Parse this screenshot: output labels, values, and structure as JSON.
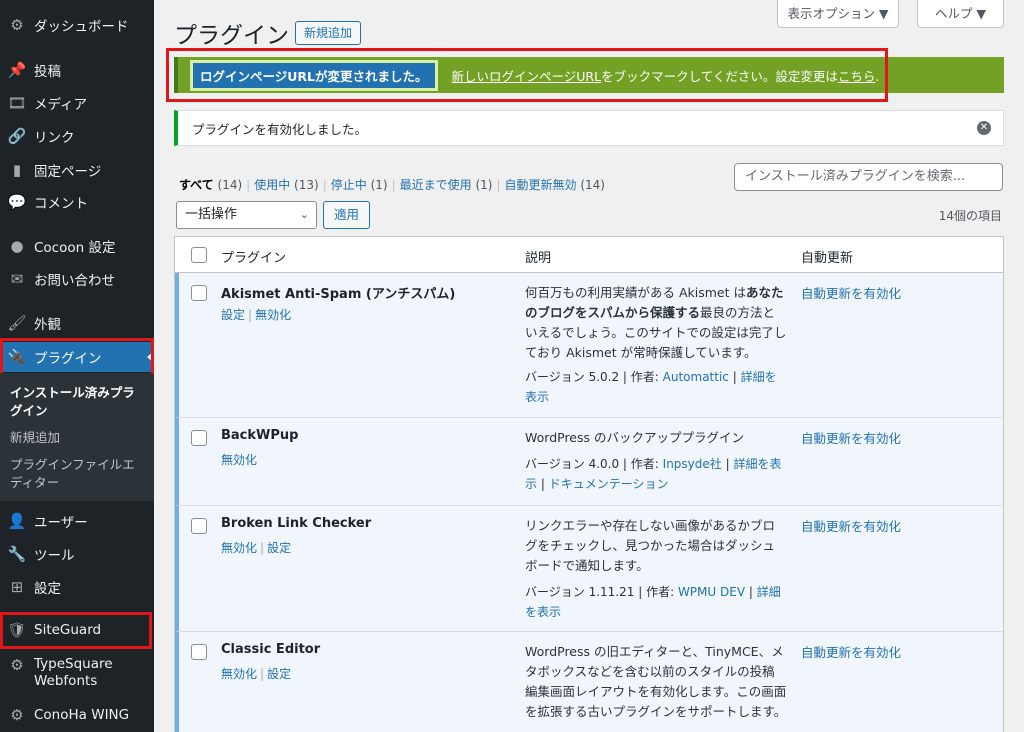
{
  "sidebar": {
    "items": [
      {
        "icon": "dashboard-icon",
        "glyph": "⚙",
        "label": "ダッシュボード"
      },
      {
        "icon": "pin-icon",
        "glyph": "📌",
        "label": "投稿"
      },
      {
        "icon": "media-icon",
        "glyph": "🎞",
        "label": "メディア"
      },
      {
        "icon": "link-icon",
        "glyph": "🔗",
        "label": "リンク"
      },
      {
        "icon": "page-icon",
        "glyph": "▮",
        "label": "固定ページ"
      },
      {
        "icon": "comment-icon",
        "glyph": "💬",
        "label": "コメント"
      },
      {
        "icon": "cocoon-icon",
        "glyph": "●",
        "label": "Cocoon 設定"
      },
      {
        "icon": "mail-icon",
        "glyph": "✉",
        "label": "お問い合わせ"
      },
      {
        "icon": "appearance-icon",
        "glyph": "🖌",
        "label": "外観"
      },
      {
        "icon": "plugin-icon",
        "glyph": "🔌",
        "label": "プラグイン"
      },
      {
        "icon": "user-icon",
        "glyph": "👤",
        "label": "ユーザー"
      },
      {
        "icon": "tools-icon",
        "glyph": "🔧",
        "label": "ツール"
      },
      {
        "icon": "settings-icon",
        "glyph": "⊞",
        "label": "設定"
      },
      {
        "icon": "siteguard-icon",
        "glyph": "🛡",
        "label": "SiteGuard"
      },
      {
        "icon": "typesquare-icon",
        "glyph": "⚙",
        "label": "TypeSquare Webfonts"
      },
      {
        "icon": "conoha-icon",
        "glyph": "⚙",
        "label": "ConoHa WING"
      }
    ],
    "submenu": [
      {
        "label": "インストール済みプラグイン"
      },
      {
        "label": "新規追加"
      },
      {
        "label": "プラグインファイルエディター"
      }
    ]
  },
  "header": {
    "title": "プラグイン",
    "add_new": "新規追加",
    "screen_options": "表示オプション ▼",
    "help": "ヘルプ ▼"
  },
  "notices": {
    "login_url_highlight": "ログインページURLが変更されました。",
    "login_url_link": "新しいログインページURL",
    "login_url_text": "をブックマークしてください。設定変更は",
    "login_url_here": "こちら",
    "activated": "プラグインを有効化しました。"
  },
  "filters": [
    {
      "label": "すべて",
      "count": "(14)"
    },
    {
      "label": "使用中",
      "count": "(13)"
    },
    {
      "label": "停止中",
      "count": "(1)"
    },
    {
      "label": "最近まで使用",
      "count": "(1)"
    },
    {
      "label": "自動更新無効",
      "count": "(14)"
    }
  ],
  "search": {
    "placeholder": "インストール済みプラグインを検索..."
  },
  "bulk": {
    "selected": "一括操作",
    "apply": "適用"
  },
  "item_count": "14個の項目",
  "table": {
    "headers": {
      "plugin": "プラグイン",
      "description": "説明",
      "auto_update": "自動更新"
    },
    "rows": [
      {
        "name": "Akismet Anti-Spam (アンチスパム)",
        "actions": [
          "設定",
          "無効化"
        ],
        "desc_1": "何百万もの利用実績がある Akismet は",
        "desc_2": "あなたのブログをスパムから保護する",
        "desc_3": "最良の方法といえるでしょう。このサイトでの設定は完了しており Akismet が常時保護しています。",
        "version": "バージョン 5.0.2",
        "author_label": "作者:",
        "author": "Automattic",
        "links": [
          "詳細を表示"
        ],
        "auto_update": "自動更新を有効化"
      },
      {
        "name": "BackWPup",
        "actions": [
          "無効化"
        ],
        "desc_1": "WordPress のバックアッププラグイン",
        "version": "バージョン 4.0.0",
        "author_label": "作者:",
        "author": "Inpsyde社",
        "links": [
          "詳細を表示",
          "ドキュメンテーション"
        ],
        "auto_update": "自動更新を有効化"
      },
      {
        "name": "Broken Link Checker",
        "actions": [
          "無効化",
          "設定"
        ],
        "desc_1": "リンクエラーや存在しない画像があるかブログをチェックし、見つかった場合はダッシュボードで通知します。",
        "version": "バージョン 1.11.21",
        "author_label": "作者:",
        "author": "WPMU DEV",
        "links": [
          "詳細を表示"
        ],
        "auto_update": "自動更新を有効化"
      },
      {
        "name": "Classic Editor",
        "actions": [
          "無効化",
          "設定"
        ],
        "desc_1": "WordPress の旧エディターと、TinyMCE、メタボックスなどを含む以前のスタイルの投稿編集画面レイアウトを有効化します。この画面を拡張する古いプラグインをサポートします。",
        "auto_update": "自動更新を有効化"
      }
    ]
  }
}
